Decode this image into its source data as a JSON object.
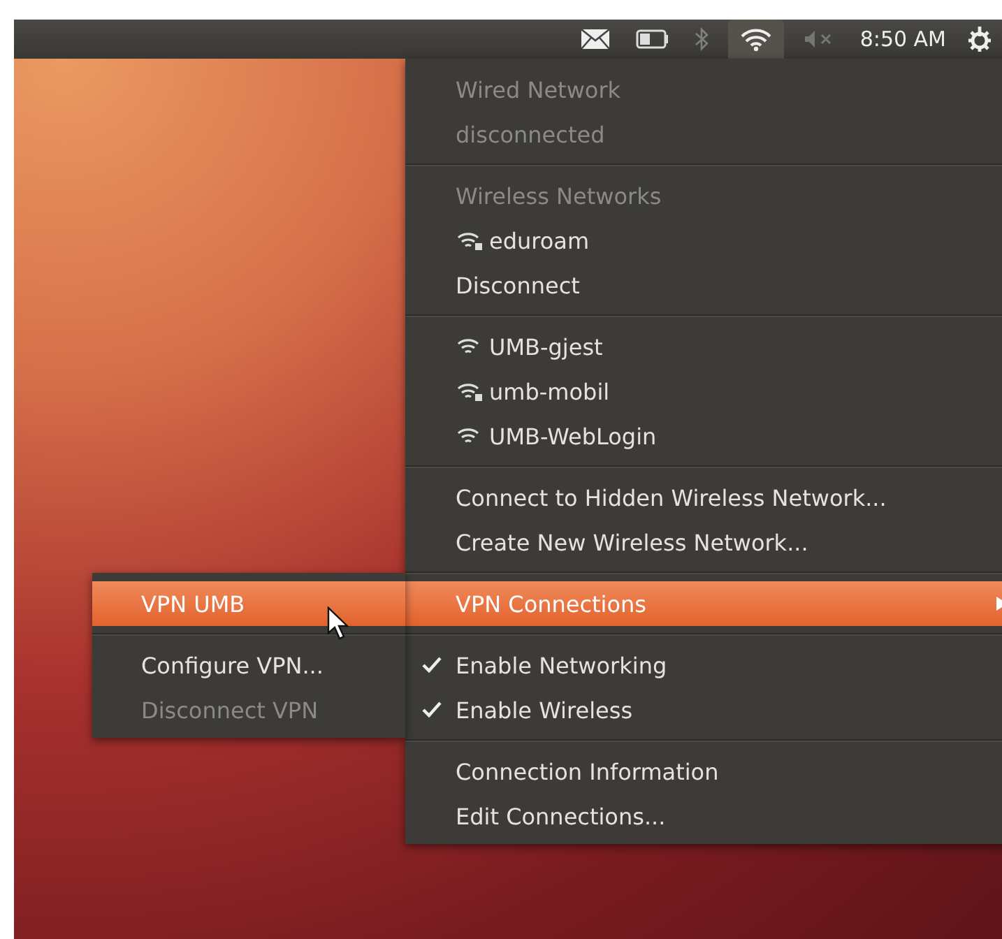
{
  "panel": {
    "indicators": [
      {
        "kind": "mail",
        "selected": false,
        "disabled": false
      },
      {
        "kind": "battery",
        "selected": false,
        "disabled": false
      },
      {
        "kind": "bluetooth",
        "selected": false,
        "disabled": true
      },
      {
        "kind": "wifi",
        "selected": true,
        "disabled": false
      },
      {
        "kind": "volume-muted",
        "selected": false,
        "disabled": true
      }
    ],
    "clock": "8:50 AM"
  },
  "menu": {
    "sections": [
      [
        {
          "label": "Wired Network",
          "kind": "header",
          "disabled": true
        },
        {
          "label": "disconnected",
          "kind": "header",
          "disabled": true
        }
      ],
      [
        {
          "label": "Wireless Networks",
          "kind": "header",
          "disabled": true
        },
        {
          "label": "eduroam",
          "kind": "network",
          "secured": true
        },
        {
          "label": "Disconnect",
          "kind": "action",
          "disabled": false
        }
      ],
      [
        {
          "label": "UMB-gjest",
          "kind": "network",
          "secured": false
        },
        {
          "label": "umb-mobil",
          "kind": "network",
          "secured": true
        },
        {
          "label": "UMB-WebLogin",
          "kind": "network",
          "secured": false
        }
      ],
      [
        {
          "label": "Connect to Hidden Wireless Network...",
          "kind": "action",
          "disabled": false
        },
        {
          "label": "Create New Wireless Network...",
          "kind": "action",
          "disabled": false
        }
      ],
      [
        {
          "label": "VPN Connections",
          "kind": "submenu",
          "selected": true
        }
      ],
      [
        {
          "label": "Enable Networking",
          "kind": "toggle",
          "checked": true
        },
        {
          "label": "Enable Wireless",
          "kind": "toggle",
          "checked": true
        }
      ],
      [
        {
          "label": "Connection Information",
          "kind": "action",
          "disabled": false
        },
        {
          "label": "Edit Connections...",
          "kind": "action",
          "disabled": false
        }
      ]
    ]
  },
  "submenu": {
    "sections": [
      [
        {
          "label": "VPN UMB",
          "selected": true,
          "disabled": false
        }
      ],
      [
        {
          "label": "Configure VPN...",
          "selected": false,
          "disabled": false
        },
        {
          "label": "Disconnect VPN",
          "selected": false,
          "disabled": true
        }
      ]
    ]
  }
}
